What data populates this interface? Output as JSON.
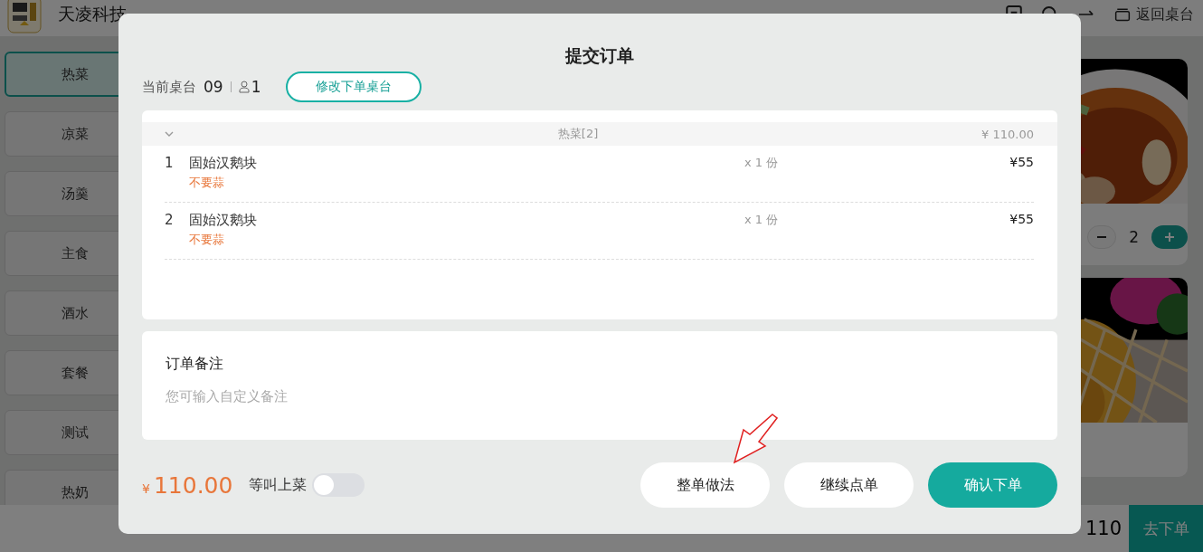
{
  "header": {
    "store_name": "天凌科技",
    "actions": [
      {
        "kind": "orders"
      },
      {
        "kind": "search"
      },
      {
        "kind": "switch"
      },
      {
        "kind": "tables",
        "label": "返回桌台"
      }
    ]
  },
  "categories": [
    {
      "label": "热菜",
      "selected": true
    },
    {
      "label": "凉菜",
      "selected": false
    },
    {
      "label": "汤羹",
      "selected": false
    },
    {
      "label": "主食",
      "selected": false
    },
    {
      "label": "酒水",
      "selected": false
    },
    {
      "label": "套餐",
      "selected": false
    },
    {
      "label": "测试",
      "selected": false
    },
    {
      "label": "热奶",
      "selected": false
    }
  ],
  "menu_cards": [
    {
      "kind": "picture",
      "quantity": "2"
    },
    {
      "kind": "picture"
    }
  ],
  "cart_bar": {
    "total": "110",
    "button": "去下单"
  },
  "dialog": {
    "title": "提交订单",
    "table_label": "当前桌台",
    "table": "09",
    "guests": "1",
    "change_table_button": "修改下单桌台",
    "group": {
      "name": "热菜[2]",
      "subtotal": "¥ 110.00",
      "expanded": true
    },
    "items": [
      {
        "index": "1",
        "name": "固始汉鹅块",
        "note": "不要蒜",
        "quantity": "x 1 份",
        "price": "¥55"
      },
      {
        "index": "2",
        "name": "固始汉鹅块",
        "note": "不要蒜",
        "quantity": "x 1 份",
        "price": "¥55"
      }
    ],
    "remark": {
      "label": "订单备注",
      "placeholder": "您可输入自定义备注"
    },
    "total": {
      "currency": "¥",
      "amount": "110.00"
    },
    "wait_serve": {
      "label": "等叫上菜",
      "on": false
    },
    "buttons": [
      {
        "kind": "secondary",
        "label": "整单做法"
      },
      {
        "kind": "secondary",
        "label": "继续点单"
      },
      {
        "kind": "primary",
        "label": "确认下单"
      }
    ]
  }
}
